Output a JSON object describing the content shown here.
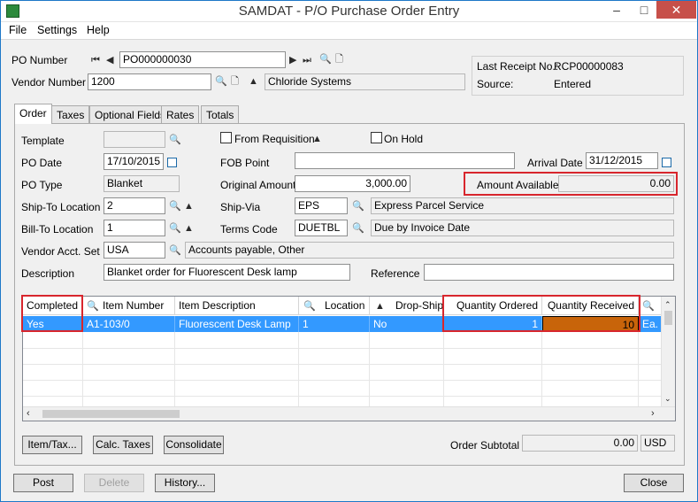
{
  "window": {
    "title": "SAMDAT - P/O Purchase Order Entry",
    "minimize": "–",
    "maximize": "□",
    "close": "✕"
  },
  "menu": [
    "File",
    "Settings",
    "Help"
  ],
  "header": {
    "po_number_label": "PO Number",
    "po_number": "PO000000030",
    "vendor_number_label": "Vendor Number",
    "vendor_number": "1200",
    "vendor_name": "Chloride Systems",
    "last_receipt_label": "Last Receipt No.:",
    "last_receipt": "RCP00000083",
    "source_label": "Source:",
    "source": "Entered"
  },
  "tabs": [
    "Order",
    "Taxes",
    "Optional Fields",
    "Rates",
    "Totals"
  ],
  "form": {
    "template_label": "Template",
    "template": "",
    "from_requisition_label": "From Requisition",
    "on_hold_label": "On Hold",
    "po_date_label": "PO Date",
    "po_date": "17/10/2015",
    "fob_point_label": "FOB Point",
    "fob_point": "",
    "arrival_date_label": "Arrival Date",
    "arrival_date": "31/12/2015",
    "po_type_label": "PO Type",
    "po_type": "Blanket",
    "original_amount_label": "Original Amount",
    "original_amount": "3,000.00",
    "amount_available_label": "Amount Available",
    "amount_available": "0.00",
    "ship_to_label": "Ship-To Location",
    "ship_to": "2",
    "ship_via_label": "Ship-Via",
    "ship_via": "EPS",
    "ship_via_desc": "Express Parcel Service",
    "bill_to_label": "Bill-To Location",
    "bill_to": "1",
    "terms_label": "Terms Code",
    "terms": "DUETBL",
    "terms_desc": "Due by Invoice Date",
    "vendor_acct_label": "Vendor Acct. Set",
    "vendor_acct": "USA",
    "vendor_acct_desc": "Accounts payable, Other",
    "description_label": "Description",
    "description": "Blanket order for Fluorescent Desk lamp",
    "reference_label": "Reference",
    "reference": ""
  },
  "grid": {
    "columns": [
      "Completed",
      "Item Number",
      "Item Description",
      "Location",
      "Drop-Ship",
      "Quantity Ordered",
      "Quantity Received"
    ],
    "row": {
      "completed": "Yes",
      "item_number": "A1-103/0",
      "item_description": "Fluorescent Desk Lamp",
      "location": "1",
      "drop_ship": "No",
      "qty_ordered": "1",
      "qty_received": "10",
      "uom": "Ea."
    }
  },
  "buttons": {
    "item_tax": "Item/Tax...",
    "calc_taxes": "Calc. Taxes",
    "consolidate": "Consolidate",
    "order_subtotal_label": "Order Subtotal",
    "order_subtotal": "0.00",
    "currency": "USD",
    "post": "Post",
    "delete": "Delete",
    "history": "History...",
    "close": "Close"
  },
  "colors": {
    "highlight": "#3399ff",
    "received_cell": "#c8640a",
    "annotation": "#d8262d"
  }
}
